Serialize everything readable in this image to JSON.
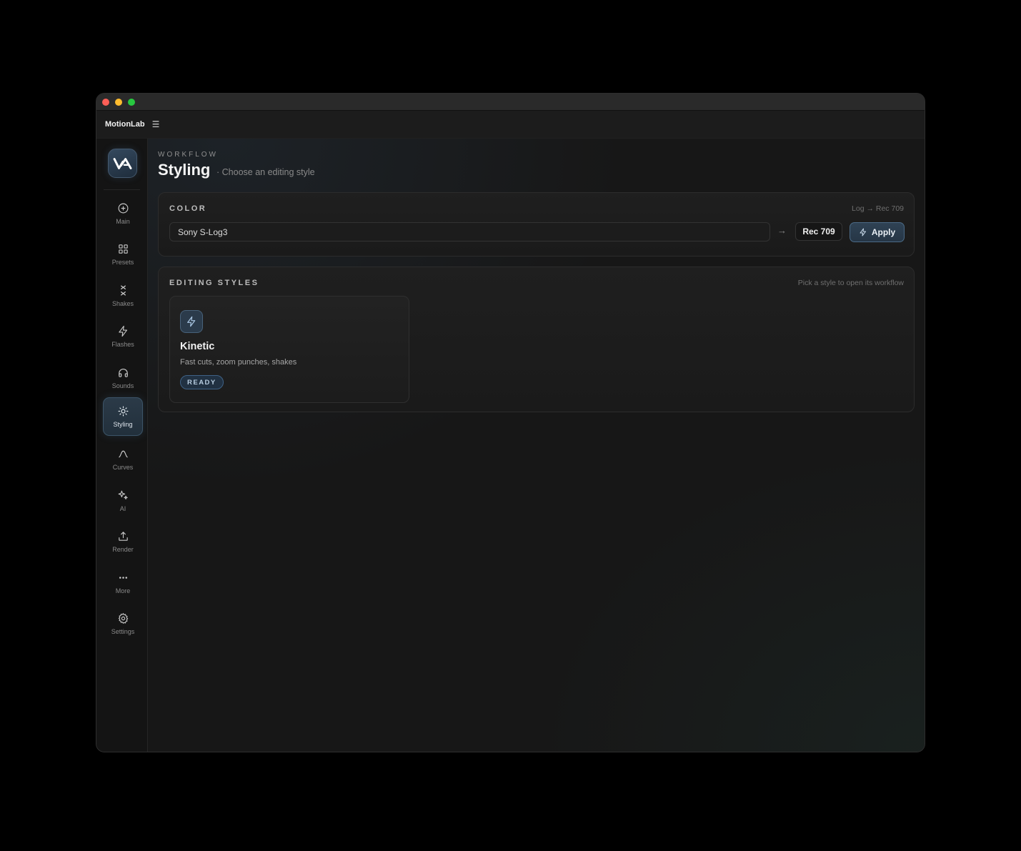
{
  "app": {
    "name": "MotionLab",
    "menu_icon": "hamburger-icon"
  },
  "sidebar": {
    "logo_icon": "motionlab-logo",
    "items": [
      {
        "label": "Main",
        "icon": "plus-circle-icon",
        "active": false
      },
      {
        "label": "Presets",
        "icon": "grid-icon",
        "active": false
      },
      {
        "label": "Shakes",
        "icon": "shake-icon",
        "active": false
      },
      {
        "label": "Flashes",
        "icon": "lightning-icon",
        "active": false
      },
      {
        "label": "Sounds",
        "icon": "headphones-icon",
        "active": false
      },
      {
        "label": "Styling",
        "icon": "sun-icon",
        "active": true
      },
      {
        "label": "Curves",
        "icon": "curve-icon",
        "active": false
      },
      {
        "label": "AI",
        "icon": "sparkles-icon",
        "active": false
      },
      {
        "label": "Render",
        "icon": "upload-icon",
        "active": false
      },
      {
        "label": "More",
        "icon": "more-icon",
        "active": false
      },
      {
        "label": "Settings",
        "icon": "gear-icon",
        "active": false
      }
    ]
  },
  "header": {
    "kicker": "WORKFLOW",
    "title": "Styling",
    "subtitle": "· Choose an editing style"
  },
  "color_panel": {
    "title": "COLOR",
    "hint": "Log → Rec 709",
    "source_profile": "Sony S-Log3",
    "arrow": "→",
    "target": "Rec 709",
    "apply_label": "Apply"
  },
  "styles_panel": {
    "title": "EDITING STYLES",
    "hint": "Pick a style to open its workflow",
    "cards": [
      {
        "title": "Kinetic",
        "description": "Fast cuts, zoom punches, shakes",
        "status": "READY",
        "icon": "lightning-icon"
      }
    ]
  },
  "colors": {
    "accent": "#4b6a86",
    "background": "#171717",
    "sidebar": "#141414"
  }
}
